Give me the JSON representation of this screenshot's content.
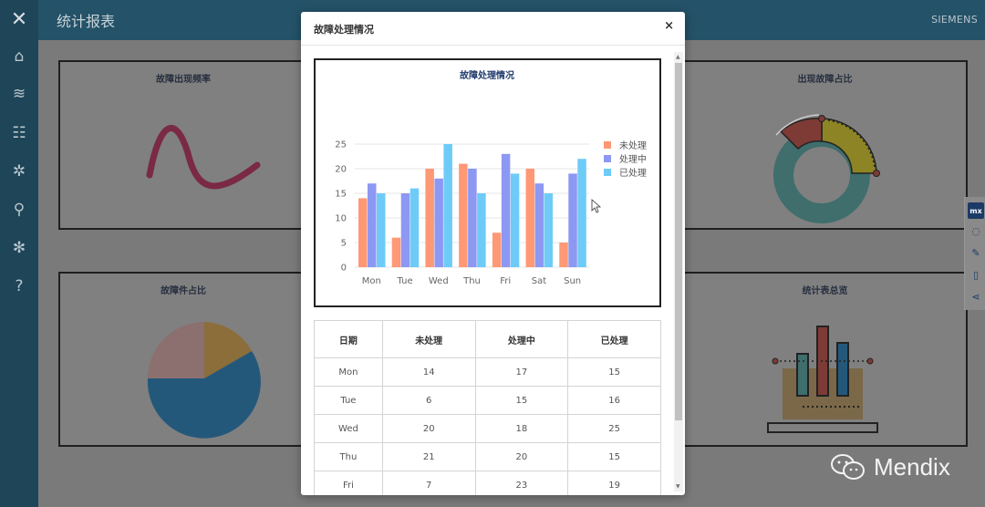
{
  "app": {
    "title": "统计报表",
    "brand": "SIEMENS"
  },
  "sidebar": {
    "items": [
      {
        "icon": "tools-icon",
        "glyph": "✕"
      },
      {
        "icon": "home-icon",
        "glyph": "⌂"
      },
      {
        "icon": "wifi-icon",
        "glyph": "≋"
      },
      {
        "icon": "users-icon",
        "glyph": "☷"
      },
      {
        "icon": "gear-icon",
        "glyph": "✲"
      },
      {
        "icon": "search-icon",
        "glyph": "⚲"
      },
      {
        "icon": "cogs-icon",
        "glyph": "✻"
      },
      {
        "icon": "help-icon",
        "glyph": "?"
      }
    ]
  },
  "tiles": {
    "frequency": {
      "title": "故障出现频率"
    },
    "ratio": {
      "title": "出现故障占比"
    },
    "share": {
      "title": "故障件占比"
    },
    "overview": {
      "title": "统计表总览"
    }
  },
  "modal": {
    "title": "故障处理情况",
    "close": "×"
  },
  "chart_data": {
    "type": "bar",
    "title": "故障处理情况",
    "categories": [
      "Mon",
      "Tue",
      "Wed",
      "Thu",
      "Fri",
      "Sat",
      "Sun"
    ],
    "series": [
      {
        "name": "未处理",
        "values": [
          14,
          6,
          20,
          21,
          7,
          20,
          5
        ],
        "color": "#ff9875"
      },
      {
        "name": "处理中",
        "values": [
          17,
          15,
          18,
          20,
          23,
          17,
          19
        ],
        "color": "#8d98f3"
      },
      {
        "name": "已处理",
        "values": [
          15,
          16,
          25,
          15,
          19,
          15,
          22
        ],
        "color": "#6ecbf8"
      }
    ],
    "yticks": [
      0,
      5,
      10,
      15,
      20,
      25
    ],
    "ylim": [
      0,
      25
    ],
    "grid": true,
    "legend": "right"
  },
  "table": {
    "headers": [
      "日期",
      "未处理",
      "处理中",
      "已处理"
    ],
    "rows": [
      [
        "Mon",
        "14",
        "17",
        "15"
      ],
      [
        "Tue",
        "6",
        "15",
        "16"
      ],
      [
        "Wed",
        "20",
        "18",
        "25"
      ],
      [
        "Thu",
        "21",
        "20",
        "15"
      ],
      [
        "Fri",
        "7",
        "23",
        "19"
      ]
    ]
  },
  "side_tools": [
    {
      "icon": "mx-icon",
      "glyph": "mx"
    },
    {
      "icon": "chat-icon",
      "glyph": "◌"
    },
    {
      "icon": "pencil-icon",
      "glyph": "✎"
    },
    {
      "icon": "mobile-icon",
      "glyph": "▯"
    },
    {
      "icon": "share-icon",
      "glyph": "⋖"
    }
  ],
  "watermark": {
    "text": "Mendix"
  },
  "colors": {
    "sidebar": "#1e4558",
    "header": "#245268",
    "overlay": "#7a7a7a"
  }
}
